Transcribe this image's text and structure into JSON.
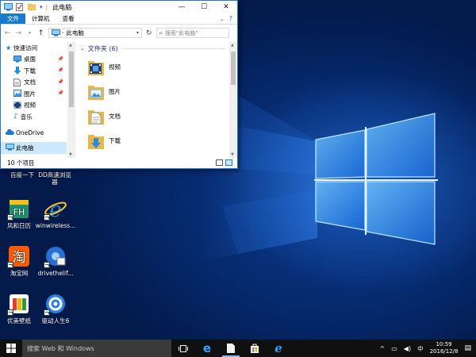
{
  "window": {
    "title": "此电脑",
    "ribbon_tabs": [
      "文件",
      "计算机",
      "查看"
    ],
    "address": "此电脑",
    "search_placeholder": "搜索\"此电脑\"",
    "nav": {
      "quick_access": "快速访问",
      "items": [
        {
          "label": "桌面",
          "icon": "desktop-icon",
          "pinned": true
        },
        {
          "label": "下载",
          "icon": "download-arrow-icon",
          "pinned": true
        },
        {
          "label": "文档",
          "icon": "document-icon",
          "pinned": true
        },
        {
          "label": "图片",
          "icon": "picture-icon",
          "pinned": true
        },
        {
          "label": "视频",
          "icon": "video-icon",
          "pinned": false
        },
        {
          "label": "音乐",
          "icon": "music-note-icon",
          "pinned": false
        }
      ],
      "onedrive": "OneDrive",
      "this_pc": "此电脑"
    },
    "group_header": "文件夹 (6)",
    "folders": [
      {
        "label": "视频",
        "icon": "video-folder-icon"
      },
      {
        "label": "图片",
        "icon": "pictures-folder-icon"
      },
      {
        "label": "文档",
        "icon": "documents-folder-icon"
      },
      {
        "label": "下载",
        "icon": "downloads-folder-icon"
      }
    ],
    "status": "10 个项目"
  },
  "desktop_icons": [
    {
      "label": "百度一下",
      "icon": "baidu-icon"
    },
    {
      "label": "DD高速浏览器",
      "icon": "dd-browser-icon"
    },
    {
      "label": "风和日历",
      "icon": "fenghe-calendar-icon"
    },
    {
      "label": "winwireless...",
      "icon": "internet-explorer-icon"
    },
    {
      "label": "淘宝网",
      "icon": "taobao-icon"
    },
    {
      "label": "drivethelif...",
      "icon": "drivethelife-icon"
    },
    {
      "label": "优美壁纸",
      "icon": "youmei-wallpaper-icon"
    },
    {
      "label": "驱动人生6",
      "icon": "driver-life-6-icon"
    }
  ],
  "taskbar": {
    "search_placeholder": "搜索 Web 和 Windows",
    "pinned": [
      "task-view-icon",
      "edge-icon",
      "file-explorer-icon",
      "store-icon",
      "internet-explorer-icon"
    ],
    "ime": "中",
    "time": "10:59",
    "date": "2016/12/8"
  },
  "colors": {
    "accent": "#1979ca",
    "wallpaper_dark": "#031a4b",
    "wallpaper_light": "#3f9cff",
    "taskbar": "#101010"
  }
}
